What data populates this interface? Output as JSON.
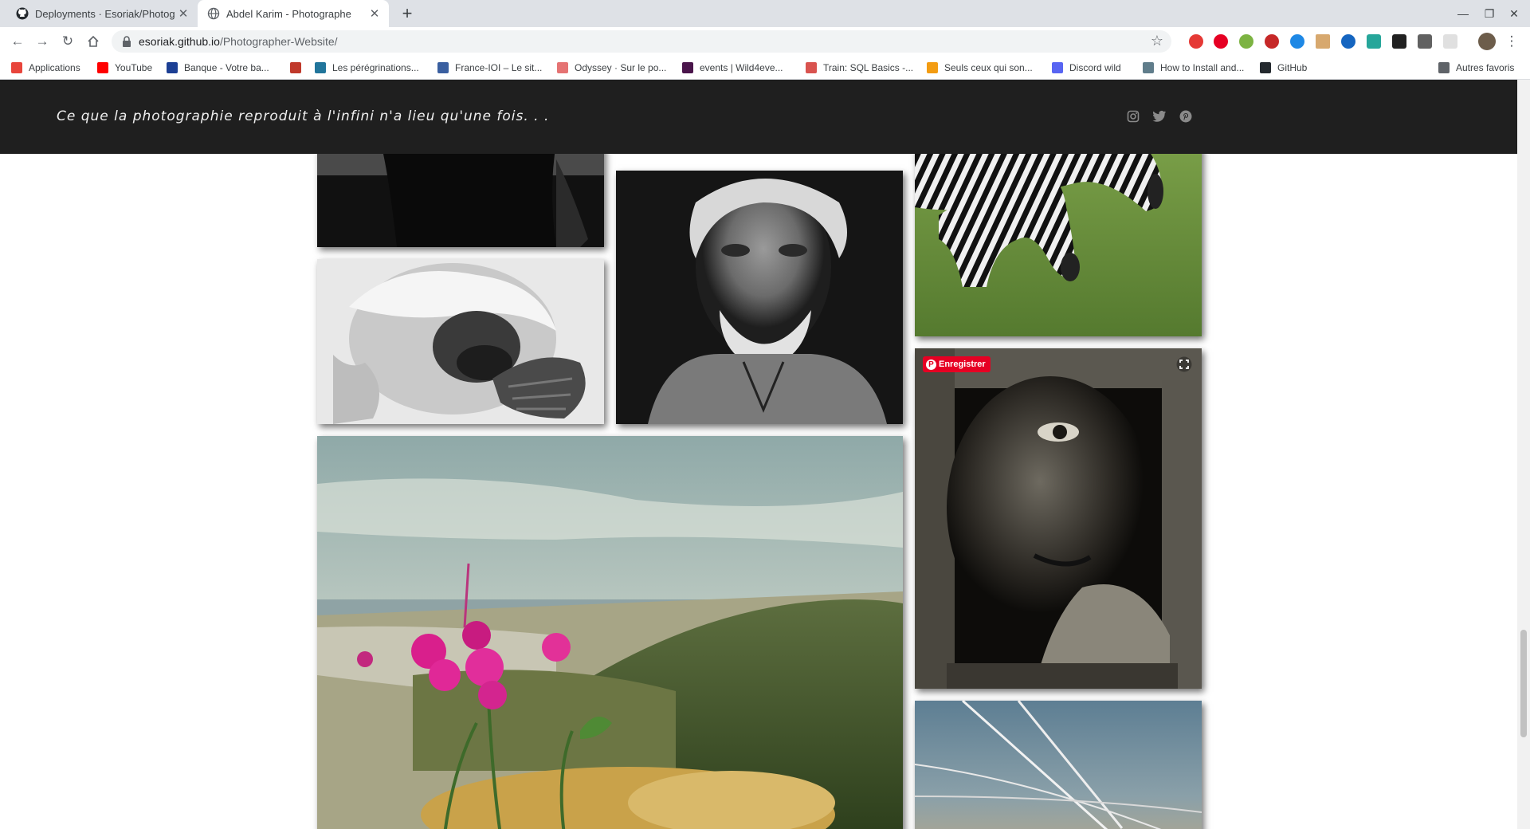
{
  "browser": {
    "tabs": [
      {
        "title": "Deployments · Esoriak/Photogr",
        "active": false
      },
      {
        "title": "Abdel Karim - Photographe",
        "active": true
      }
    ],
    "url_host": "esoriak.github.io",
    "url_path": "/Photographer-Website/",
    "bookmarks": [
      {
        "label": "Applications",
        "icon": "apps-grid-icon",
        "color": "#e8453c"
      },
      {
        "label": "YouTube",
        "icon": "youtube-icon",
        "color": "#ff0000"
      },
      {
        "label": "Banque - Votre ba...",
        "icon": "bank-icon",
        "color": "#1c3f94"
      },
      {
        "label": "",
        "icon": "heart-icon",
        "color": "#c0392b"
      },
      {
        "label": "Les pérégrinations...",
        "icon": "wordpress-icon",
        "color": "#21759b"
      },
      {
        "label": "France-IOI – Le sit...",
        "icon": "franceioi-icon",
        "color": "#3a5fa0"
      },
      {
        "label": "Odyssey · Sur le po...",
        "icon": "odyssey-icon",
        "color": "#e57373"
      },
      {
        "label": "events | Wild4eve...",
        "icon": "slack-icon",
        "color": "#4a154b"
      },
      {
        "label": "Train: SQL Basics -...",
        "icon": "train-icon",
        "color": "#d9534f"
      },
      {
        "label": "Seuls ceux qui son...",
        "icon": "figure-icon",
        "color": "#f39c12"
      },
      {
        "label": "Discord wild",
        "icon": "discord-icon",
        "color": "#5865f2"
      },
      {
        "label": "How to Install and...",
        "icon": "page-icon",
        "color": "#607d8b"
      },
      {
        "label": "GitHub",
        "icon": "github-icon",
        "color": "#24292e"
      }
    ],
    "other_bookmarks": "Autres favoris"
  },
  "site": {
    "tagline": "Ce que la photographie reproduit à l'infini n'a lieu qu'une fois. . .",
    "social_icons": [
      "instagram-icon",
      "twitter-icon",
      "pinterest-icon"
    ],
    "pin_save_label": "Enregistrer",
    "photos": [
      {
        "subject": "dark figure (partial)",
        "name": "photo-dark-figure"
      },
      {
        "subject": "old man portrait",
        "name": "photo-old-man"
      },
      {
        "subject": "zebras",
        "name": "photo-zebras"
      },
      {
        "subject": "monkey",
        "name": "photo-monkey"
      },
      {
        "subject": "crying child behind window",
        "name": "photo-child"
      },
      {
        "subject": "landscape with pink flowers",
        "name": "photo-landscape"
      },
      {
        "subject": "sky with contrails",
        "name": "photo-sky"
      }
    ]
  },
  "colors": {
    "header_bg": "#1f1f1f",
    "tagline": "#f0f0f0",
    "pin_red": "#e60023"
  }
}
